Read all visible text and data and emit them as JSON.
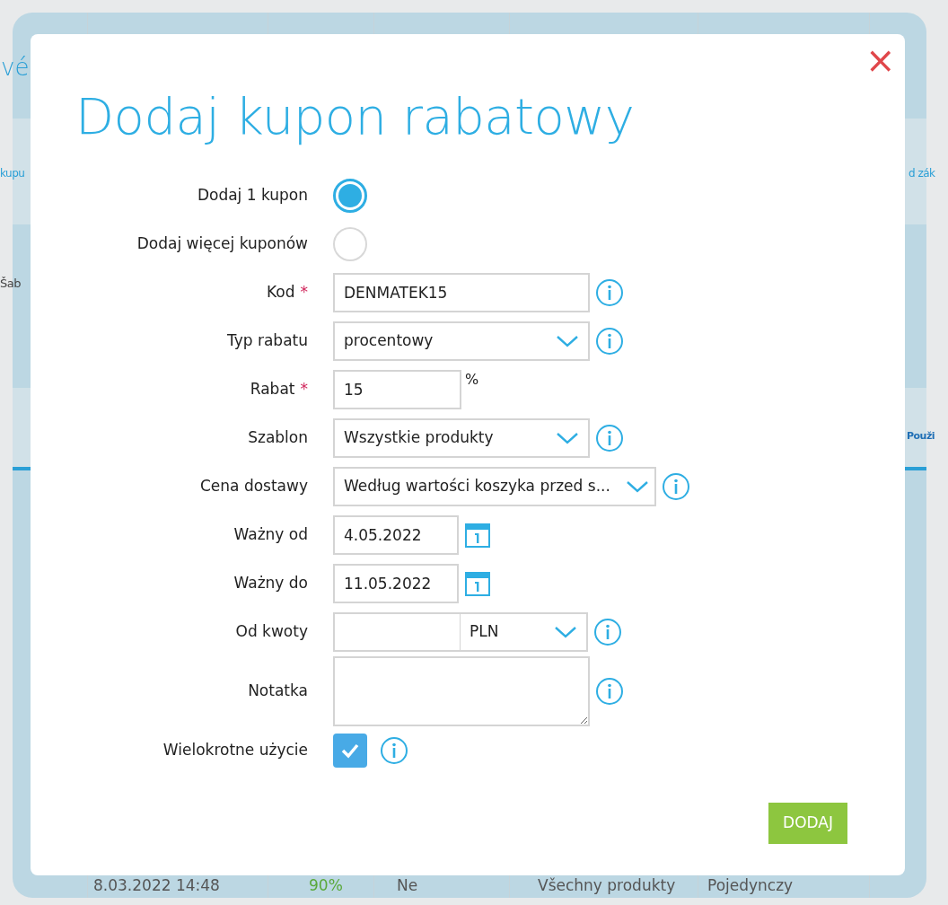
{
  "background": {
    "heading": "vé",
    "tab_left": "kupu",
    "tab_right": "d zák",
    "column_left": "Šab",
    "column_right": "Použi",
    "row": [
      "8.03.2022 14:48",
      "90%",
      "Ne",
      "Všechny produkty",
      "Pojedynczy"
    ]
  },
  "dialog": {
    "title": "Dodaj kupon rabatowy",
    "close": "×",
    "fields": [
      {
        "kind": "radio",
        "label": "Dodaj 1 kupon",
        "selected": true
      },
      {
        "kind": "radio",
        "label": "Dodaj więcej kuponów",
        "selected": false
      },
      {
        "kind": "text",
        "label": "Kod",
        "required_mark": "*",
        "value": "DENMATEK15",
        "info": true
      },
      {
        "kind": "select",
        "label": "Typ rabatu",
        "value": "procentowy",
        "info": true
      },
      {
        "kind": "number",
        "label": "Rabat",
        "required_mark": "*",
        "value": "15",
        "unit": "%",
        "info": false
      },
      {
        "kind": "select",
        "label": "Szablon",
        "value": "Wszystkie produkty",
        "info": true
      },
      {
        "kind": "select",
        "label": "Cena dostawy",
        "value": "Według wartości koszyka przed s...",
        "info": true
      },
      {
        "kind": "date",
        "label": "Ważny od",
        "value": "4.05.2022",
        "info": false
      },
      {
        "kind": "date",
        "label": "Ważny do",
        "value": "11.05.2022",
        "info": false
      },
      {
        "kind": "amount",
        "label": "Od kwoty",
        "currency": "PLN",
        "info": true
      },
      {
        "kind": "textarea",
        "label": "Notatka",
        "info": true
      },
      {
        "kind": "checkbox",
        "label": "Wielokrotne użycie",
        "checked": true,
        "info": true
      }
    ],
    "submit": "DODAJ"
  }
}
